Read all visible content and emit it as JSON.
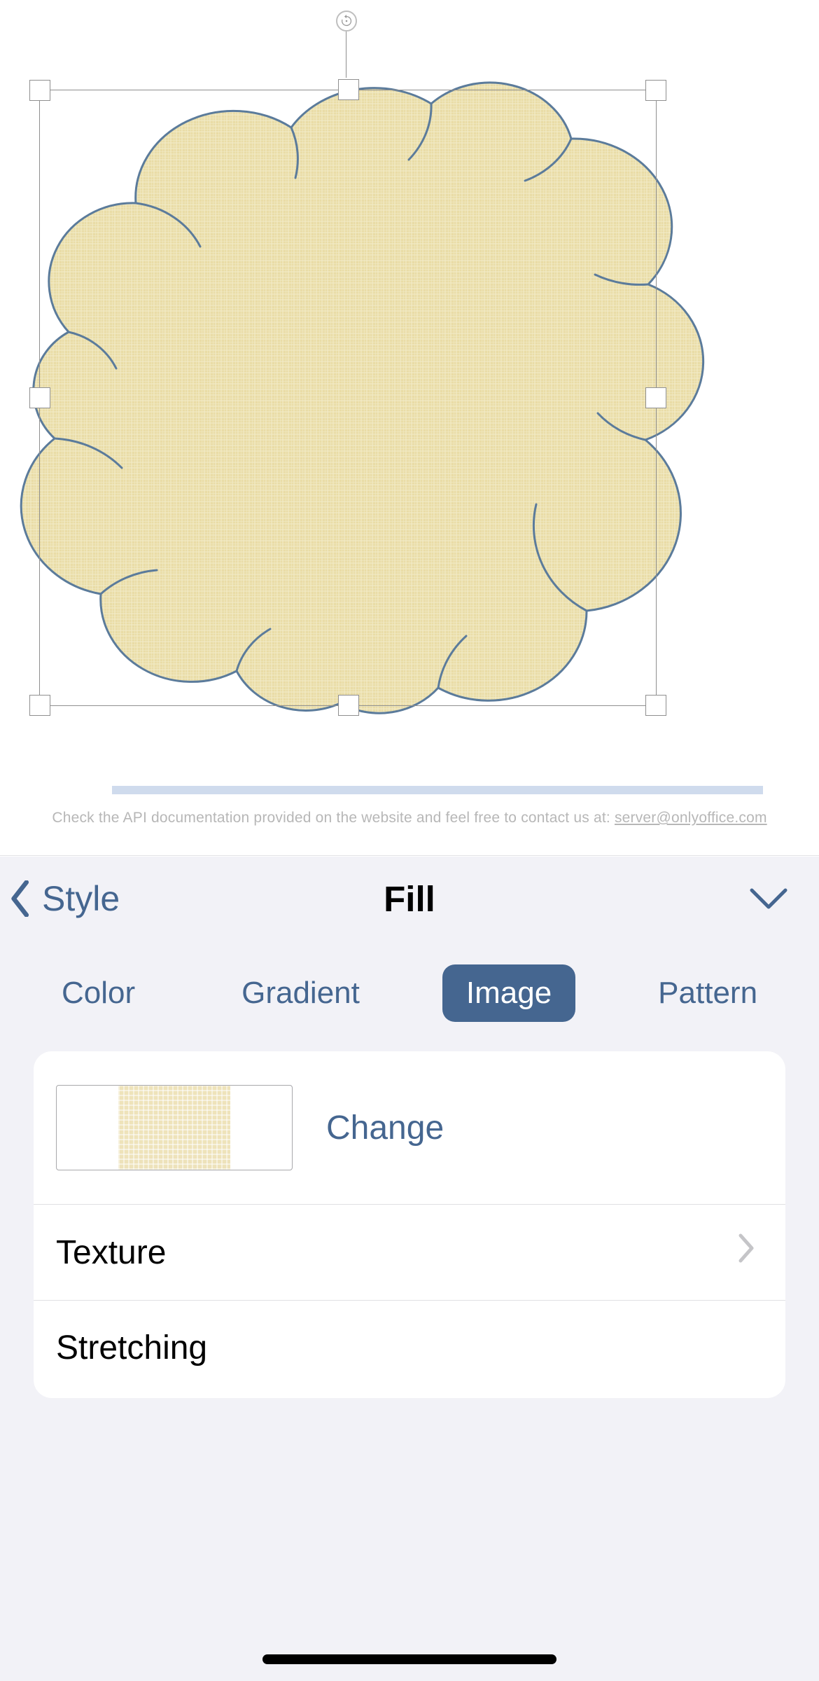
{
  "footer": {
    "text_before": "Check the API documentation provided on the website and feel free to contact us at: ",
    "email": "server@onlyoffice.com"
  },
  "sheet": {
    "back_label": "Style",
    "title": "Fill",
    "tabs": {
      "color": "Color",
      "gradient": "Gradient",
      "image": "Image",
      "pattern": "Pattern",
      "active": "image"
    },
    "rows": {
      "change": "Change",
      "texture": "Texture",
      "stretching": "Stretching"
    }
  },
  "colors": {
    "shape_fill": "#e9dca6",
    "shape_stroke": "#5b7b9b",
    "accent": "#456690"
  }
}
